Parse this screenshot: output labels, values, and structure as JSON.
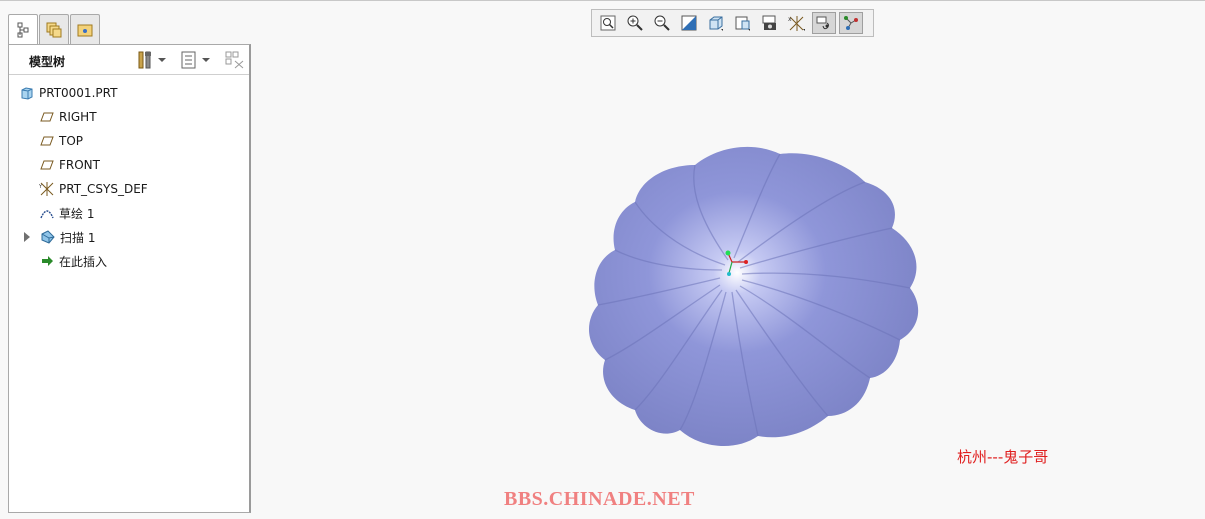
{
  "panel": {
    "title": "模型树",
    "tabs": [
      "model-tree-tab",
      "layers-tab",
      "folder-browser-tab"
    ]
  },
  "tree": {
    "items": [
      {
        "label": "PRT0001.PRT",
        "icon": "part-icon"
      },
      {
        "label": "RIGHT",
        "icon": "datum-plane-icon"
      },
      {
        "label": "TOP",
        "icon": "datum-plane-icon"
      },
      {
        "label": "FRONT",
        "icon": "datum-plane-icon"
      },
      {
        "label": "PRT_CSYS_DEF",
        "icon": "coordinate-system-icon"
      },
      {
        "label": "草绘 1",
        "icon": "sketch-icon"
      },
      {
        "label": "扫描 1",
        "icon": "sweep-icon"
      },
      {
        "label": "在此插入",
        "icon": "insert-here-arrow-icon"
      }
    ]
  },
  "toolbar": {
    "buttons": [
      "refit-icon",
      "zoom-in-icon",
      "zoom-out-icon",
      "repaint-icon",
      "display-style-icon",
      "saved-views-icon",
      "view-manager-icon",
      "datum-display-icon",
      "spin-center-icon",
      "annotation-display-icon"
    ]
  },
  "watermarks": {
    "name": "杭州---鬼子哥",
    "site": "BBS.CHINADE.NET"
  },
  "colors": {
    "model_fill": "#8c93d8",
    "accent_green": "#2a8a2a",
    "watermark_red": "#e02020"
  }
}
